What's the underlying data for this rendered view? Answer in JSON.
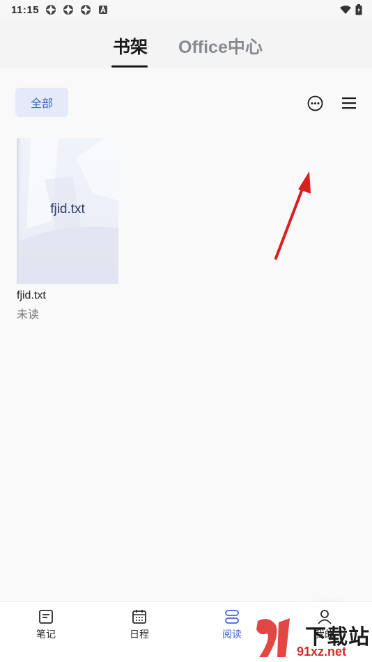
{
  "status": {
    "time": "11:15"
  },
  "tabs": {
    "shelf": "书架",
    "office": "Office中心"
  },
  "filter": {
    "label": "全部"
  },
  "book": {
    "cover_title": "fjid.txt",
    "name": "fjid.txt",
    "status": "未读"
  },
  "nav": {
    "notes": "笔记",
    "schedule": "日程",
    "reading": "阅读",
    "mine": "我的"
  },
  "watermark": {
    "brand": "下载站",
    "site": "91xz.net"
  },
  "colors": {
    "accent": "#3f66e0",
    "arrow": "#e02020"
  },
  "icons": [
    "more-circle-icon",
    "menu-icon",
    "plus-icon",
    "notes-icon",
    "calendar-icon",
    "reading-icon",
    "person-icon"
  ]
}
